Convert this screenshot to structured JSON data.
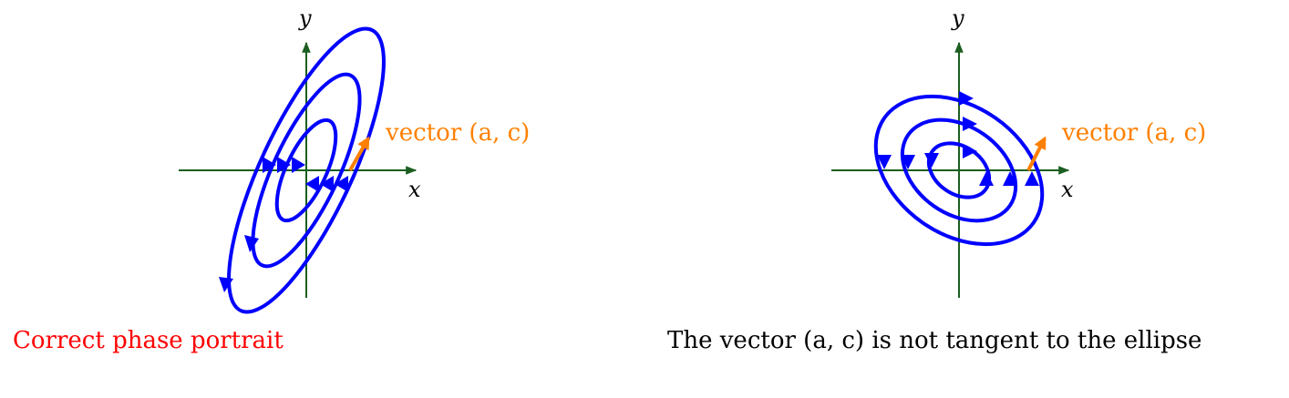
{
  "colors": {
    "axis": "#1b5e20",
    "curve": "#0000ff",
    "vector": "#ff8000",
    "caption_left": "#ff0000",
    "caption_right": "#000000"
  },
  "panels": [
    {
      "id": "left",
      "x_label": "x",
      "y_label": "y",
      "vector_label": "vector (a, c)",
      "caption": "Correct phase portrait",
      "vector": {
        "dx": 0.6,
        "dy": 1.0
      },
      "trajectory": "spiral counter-clockwise",
      "ellipse_tilt_deg": 65
    },
    {
      "id": "right",
      "x_label": "x",
      "y_label": "y",
      "vector_label": "vector (a, c)",
      "caption": "The vector (a, c) is not tangent to the ellipse",
      "vector": {
        "dx": 0.6,
        "dy": 1.0
      },
      "trajectory": "spiral counter-clockwise",
      "ellipse_tilt_deg": -35
    }
  ]
}
